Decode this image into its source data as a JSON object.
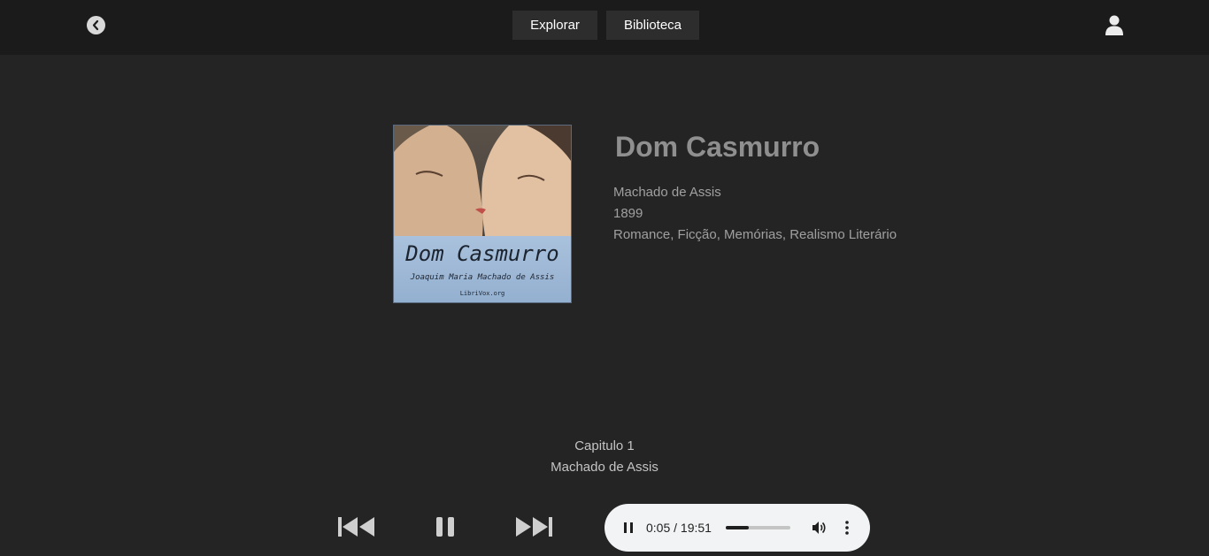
{
  "nav": {
    "back_icon": "chevron-left-icon",
    "explore_label": "Explorar",
    "library_label": "Biblioteca",
    "user_icon": "user-icon"
  },
  "book": {
    "title": "Dom Casmurro",
    "author": "Machado de Assis",
    "year": "1899",
    "genres": "Romance, Ficção, Memórias, Realismo Literário",
    "cover": {
      "title": "Dom Casmurro",
      "author": "Joaquim Maria Machado de Assis",
      "site": "LibriVox.org"
    }
  },
  "now_playing": {
    "chapter": "Capitulo 1",
    "author": "Machado de Assis"
  },
  "controls": {
    "prev_icon": "skip-previous-icon",
    "pause_icon": "pause-icon",
    "next_icon": "skip-next-icon"
  },
  "audio": {
    "time": "0:05 / 19:51",
    "progress_fraction": 0.35,
    "pause_icon": "pause-icon",
    "volume_icon": "volume-icon",
    "menu_icon": "more-vertical-icon"
  },
  "colors": {
    "background": "#242424",
    "topbar": "#1b1b1b",
    "nav_button": "#2d2d2d",
    "audio_bg": "#f1f3f4"
  }
}
